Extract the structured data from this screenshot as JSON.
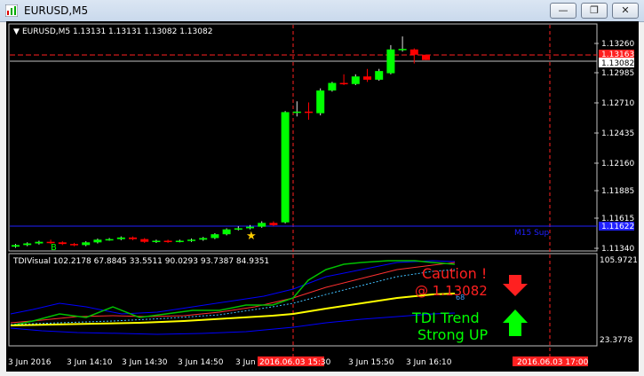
{
  "window": {
    "title": "EURUSD,M5",
    "minimize_glyph": "—",
    "restore_glyph": "❐",
    "close_glyph": "✕"
  },
  "colors": {
    "bull": "#00ff00",
    "bear": "#ff0000",
    "chart_bg": "#000000",
    "tdi_price": "#00ff00",
    "tdi_signal": "#ff0000",
    "tdi_market_base": "#ffff00",
    "tdi_bands": "#0000ff",
    "caution_text": "#ff2020",
    "trend_text": "#00ff00",
    "time_marker_bg": "#ff0000"
  },
  "main_chart": {
    "header": "EURUSD,M5  1.13131 1.13131 1.13082 1.13082",
    "y_ticks": [
      "1.13260",
      "1.12985",
      "1.12710",
      "1.12435",
      "1.12160",
      "1.11885",
      "1.11615",
      "1.11340"
    ],
    "bid_label": "1.13082",
    "ask_label": "1.13163",
    "support_label": "1.11622",
    "support_line_label": "M15 Sup",
    "arrow_marker": "B",
    "star_marker": "★"
  },
  "indicator": {
    "header": "TDIVisual 102.2178 67.8845 33.5511 90.0293 93.7387 84.9351",
    "y_top": "105.9721",
    "y_bottom": "23.3778",
    "level_label": "68",
    "caution_line1": "Caution !",
    "caution_line2": "@ 1.13082",
    "trend_line1": "TDI Trend",
    "trend_line2": "Strong UP",
    "down_arrow": "down-arrow",
    "up_arrow": "up-arrow"
  },
  "time_axis": {
    "labels": [
      "3 Jun 2016",
      "3 Jun 14:10",
      "3 Jun 14:30",
      "3 Jun 14:50",
      "3 Jun",
      "3 Jun 15:50",
      "3 Jun 16:10"
    ],
    "highlight1": "2016.06.03 15:30",
    "highlight2": "2016.06.03 17:00"
  },
  "chart_data": {
    "type": "candlestick",
    "symbol": "EURUSD",
    "timeframe": "M5",
    "ylim": [
      1.1134,
      1.1326
    ],
    "candles": [
      {
        "o": 1.11355,
        "c": 1.1137,
        "h": 1.1138,
        "l": 1.11345
      },
      {
        "o": 1.1137,
        "c": 1.11385,
        "h": 1.11395,
        "l": 1.1136
      },
      {
        "o": 1.11385,
        "c": 1.114,
        "h": 1.1141,
        "l": 1.11375
      },
      {
        "o": 1.114,
        "c": 1.1139,
        "h": 1.1142,
        "l": 1.1138
      },
      {
        "o": 1.11395,
        "c": 1.1138,
        "h": 1.11405,
        "l": 1.1137
      },
      {
        "o": 1.1138,
        "c": 1.1137,
        "h": 1.1139,
        "l": 1.1136
      },
      {
        "o": 1.1137,
        "c": 1.11395,
        "h": 1.11405,
        "l": 1.1136
      },
      {
        "o": 1.11395,
        "c": 1.1142,
        "h": 1.1143,
        "l": 1.11385
      },
      {
        "o": 1.1142,
        "c": 1.11425,
        "h": 1.11435,
        "l": 1.1141
      },
      {
        "o": 1.11425,
        "c": 1.1144,
        "h": 1.1145,
        "l": 1.11415
      },
      {
        "o": 1.1144,
        "c": 1.11425,
        "h": 1.1145,
        "l": 1.11415
      },
      {
        "o": 1.11425,
        "c": 1.114,
        "h": 1.11435,
        "l": 1.1139
      },
      {
        "o": 1.114,
        "c": 1.1141,
        "h": 1.1142,
        "l": 1.1139
      },
      {
        "o": 1.1141,
        "c": 1.114,
        "h": 1.1142,
        "l": 1.1139
      },
      {
        "o": 1.114,
        "c": 1.1141,
        "h": 1.1142,
        "l": 1.11395
      },
      {
        "o": 1.1141,
        "c": 1.1142,
        "h": 1.1143,
        "l": 1.114
      },
      {
        "o": 1.1142,
        "c": 1.11435,
        "h": 1.11445,
        "l": 1.1141
      },
      {
        "o": 1.11435,
        "c": 1.1147,
        "h": 1.1148,
        "l": 1.11425
      },
      {
        "o": 1.1147,
        "c": 1.11515,
        "h": 1.11525,
        "l": 1.1146
      },
      {
        "o": 1.11515,
        "c": 1.11525,
        "h": 1.11545,
        "l": 1.11505
      },
      {
        "o": 1.11525,
        "c": 1.1154,
        "h": 1.11555,
        "l": 1.11515
      },
      {
        "o": 1.1154,
        "c": 1.11575,
        "h": 1.1159,
        "l": 1.1153
      },
      {
        "o": 1.11575,
        "c": 1.11555,
        "h": 1.1159,
        "l": 1.11545
      },
      {
        "o": 1.1158,
        "c": 1.126,
        "h": 1.1261,
        "l": 1.1157
      },
      {
        "o": 1.126,
        "c": 1.12605,
        "h": 1.127,
        "l": 1.1256
      },
      {
        "o": 1.12605,
        "c": 1.126,
        "h": 1.1269,
        "l": 1.1253
      },
      {
        "o": 1.1259,
        "c": 1.128,
        "h": 1.1282,
        "l": 1.1257
      },
      {
        "o": 1.128,
        "c": 1.1287,
        "h": 1.1288,
        "l": 1.1279
      },
      {
        "o": 1.1287,
        "c": 1.1286,
        "h": 1.1295,
        "l": 1.1285
      },
      {
        "o": 1.1286,
        "c": 1.1293,
        "h": 1.1295,
        "l": 1.1285
      },
      {
        "o": 1.1293,
        "c": 1.129,
        "h": 1.13,
        "l": 1.1288
      },
      {
        "o": 1.129,
        "c": 1.1298,
        "h": 1.13,
        "l": 1.1289
      },
      {
        "o": 1.1296,
        "c": 1.1318,
        "h": 1.1322,
        "l": 1.1295
      },
      {
        "o": 1.1318,
        "c": 1.13185,
        "h": 1.133,
        "l": 1.1316
      },
      {
        "o": 1.1318,
        "c": 1.13131,
        "h": 1.1319,
        "l": 1.1305
      },
      {
        "o": 1.13131,
        "c": 1.13082,
        "h": 1.13131,
        "l": 1.13082
      }
    ]
  }
}
